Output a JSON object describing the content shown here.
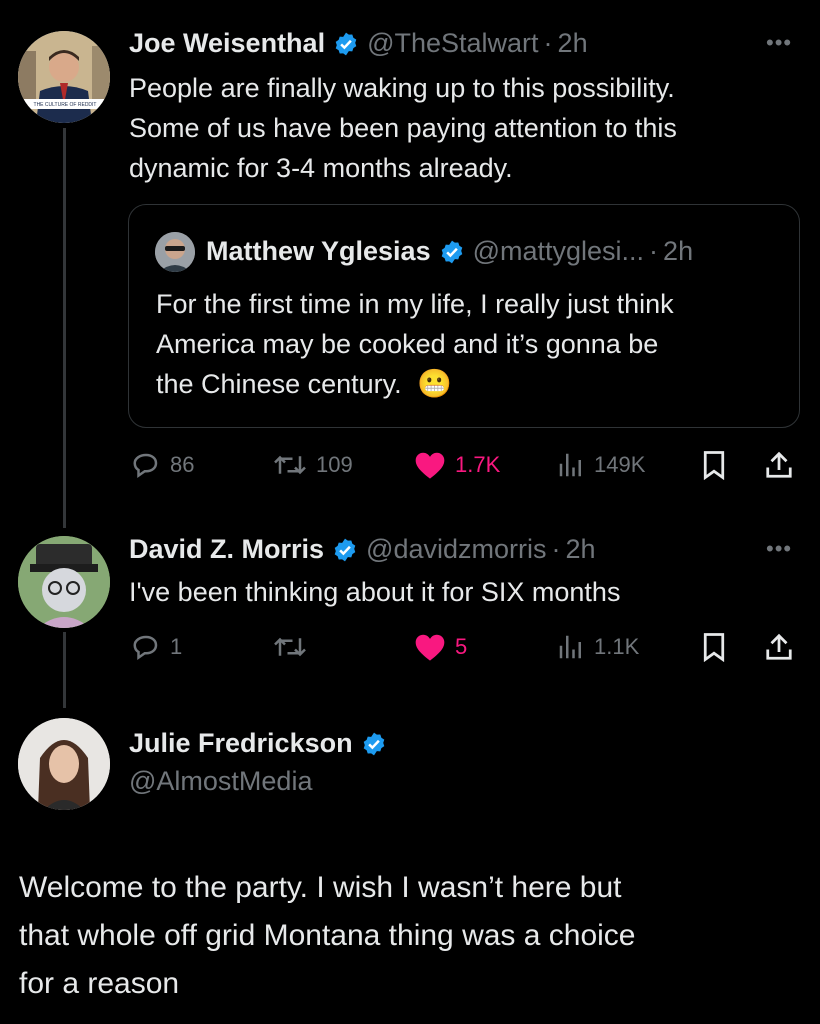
{
  "tweets": [
    {
      "author": "Joe Weisenthal",
      "handle": "@TheStalwart",
      "time": "2h",
      "avatar_caption": "THE CULTURE OF REDDIT",
      "text_lines": [
        "People are finally waking up to this possibility.",
        "Some of us have been paying attention to this",
        "dynamic for 3-4 months already."
      ],
      "quote": {
        "author": "Matthew Yglesias",
        "handle": "@mattyglesi...",
        "time": "2h",
        "text_lines": [
          "For the first time in my life, I really just think",
          "America may be cooked and it’s gonna be",
          "the Chinese century."
        ],
        "emoji": "😬"
      },
      "actions": {
        "replies": "86",
        "reposts": "109",
        "likes": "1.7K",
        "views": "149K",
        "liked": true
      }
    },
    {
      "author": "David Z. Morris",
      "handle": "@davidzmorris",
      "time": "2h",
      "text_lines": [
        "I've been thinking about it for SIX months"
      ],
      "actions": {
        "replies": "1",
        "reposts": "",
        "likes": "5",
        "views": "1.1K",
        "liked": true
      }
    },
    {
      "author": "Julie Fredrickson",
      "handle": "@AlmostMedia",
      "text_lines": [
        "Welcome to the party. I wish I wasn’t here but",
        "that whole off grid Montana thing was a choice",
        "for a reason"
      ]
    }
  ],
  "colors": {
    "background": "#000000",
    "text": "#e7e9ea",
    "muted": "#71767b",
    "verified": "#1d9bf0",
    "like": "#f91880"
  },
  "icons": {
    "reply": "reply-icon",
    "repost": "repost-icon",
    "like": "heart-icon",
    "views": "views-icon",
    "bookmark": "bookmark-icon",
    "share": "share-icon",
    "more": "more-icon"
  }
}
